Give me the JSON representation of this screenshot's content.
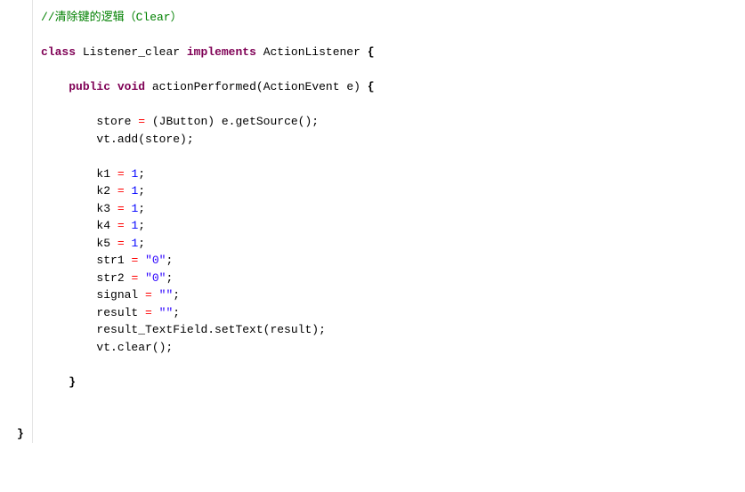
{
  "code": {
    "comment": "//清除键的逻辑（Clear）",
    "kw_class": "class",
    "class_name": "Listener_clear",
    "kw_implements": "implements",
    "iface": "ActionListener",
    "brace_open": "{",
    "brace_close": "}",
    "kw_public": "public",
    "kw_void": "void",
    "method": "actionPerformed",
    "param": "ActionEvent e",
    "l1a": "store ",
    "eq": "=",
    "l1b": " (JButton) e.getSource();",
    "l2": "vt.add(store);",
    "k1a": "k1 ",
    "k2a": "k2 ",
    "k3a": "k3 ",
    "k4a": "k4 ",
    "k5a": "k5 ",
    "one": "1",
    "semi": ";",
    "s1a": "str1 ",
    "s1v": "\"0\"",
    "s2a": "str2 ",
    "sga": "signal ",
    "sgv": "\"\"",
    "rea": "result ",
    "rl": "result_TextField.setText(result);",
    "vc": "vt.clear();",
    "sp": " "
  }
}
